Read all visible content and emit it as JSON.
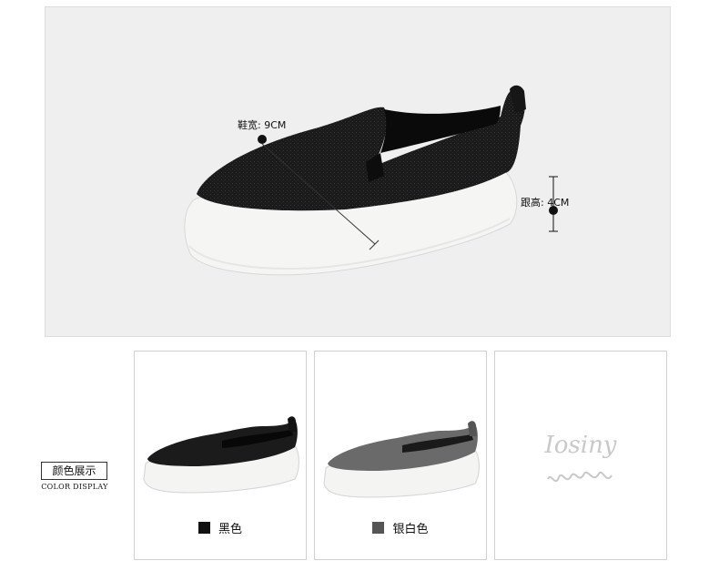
{
  "hero": {
    "width_label": "鞋宽: 9CM",
    "height_label": "跟高: 4CM"
  },
  "section": {
    "title": "颜色展示",
    "subtitle": "COLOR DISPLAY"
  },
  "colors": [
    {
      "name": "黑色",
      "swatch": "#111111"
    },
    {
      "name": "银白色",
      "swatch": "#555555"
    }
  ],
  "brand_card": {
    "logo": "Iosiny"
  }
}
